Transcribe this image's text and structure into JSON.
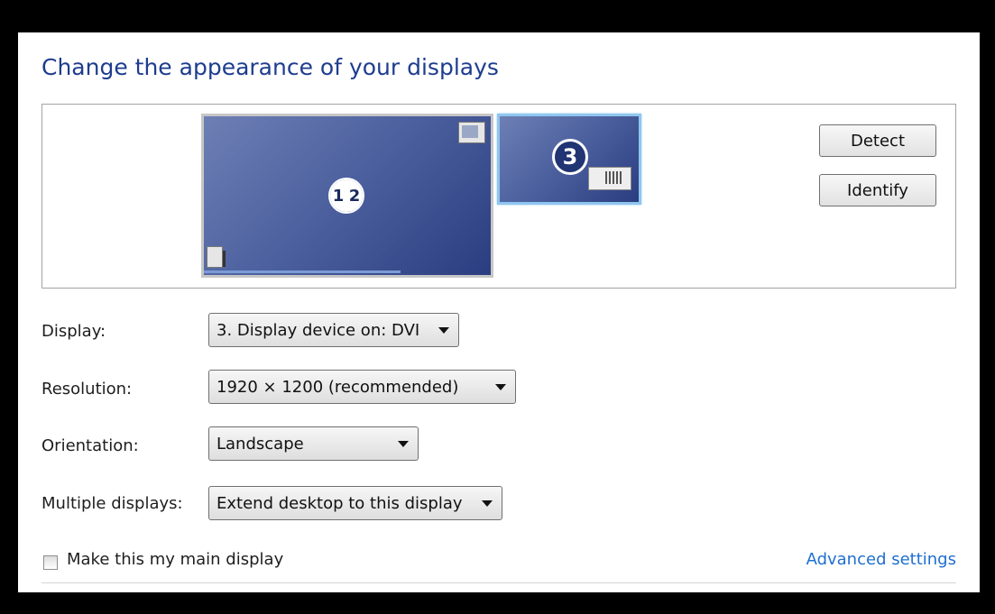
{
  "title": "Change the appearance of your displays",
  "preview": {
    "monitor_big_label_left": "1",
    "monitor_big_label_right": "2",
    "monitor_small_label": "3"
  },
  "buttons": {
    "detect": "Detect",
    "identify": "Identify"
  },
  "rows": {
    "display": {
      "label": "Display:",
      "value": "3. Display device on: DVI"
    },
    "resolution": {
      "label": "Resolution:",
      "value": "1920 × 1200 (recommended)"
    },
    "orientation": {
      "label": "Orientation:",
      "value": "Landscape"
    },
    "multiple": {
      "label": "Multiple displays:",
      "value": "Extend desktop to this display"
    }
  },
  "main_display_checkbox": {
    "label": "Make this my main display",
    "checked": false
  },
  "advanced_link": "Advanced settings"
}
